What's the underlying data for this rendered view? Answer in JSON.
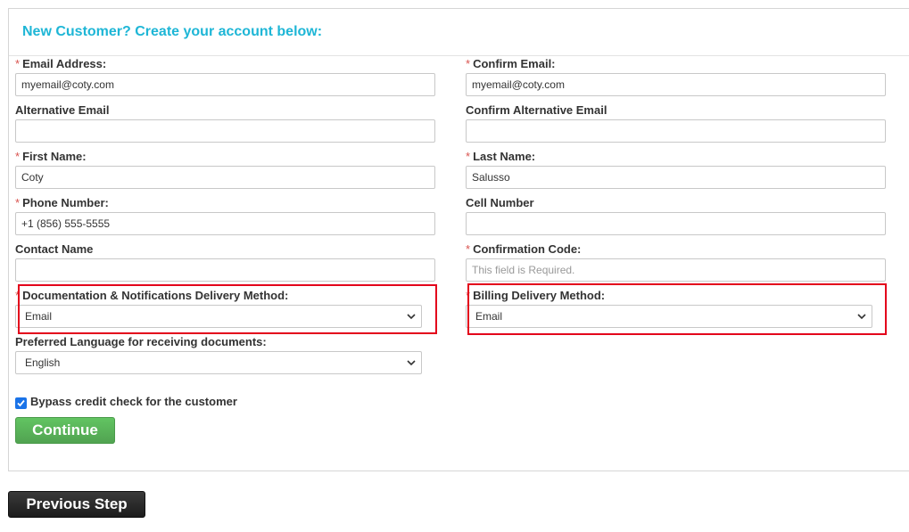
{
  "form": {
    "title": "New Customer? Create your account below:",
    "required_marker": "*",
    "left": {
      "email": {
        "label": "Email Address:",
        "value": "myemail@coty.com"
      },
      "alt_email": {
        "label": "Alternative Email",
        "value": ""
      },
      "first_name": {
        "label": "First Name:",
        "value": "Coty"
      },
      "phone": {
        "label": "Phone Number:",
        "value": "+1 (856) 555-5555"
      },
      "contact_name": {
        "label": "Contact Name",
        "value": ""
      },
      "doc_delivery": {
        "label": "Documentation & Notifications Delivery Method:",
        "value": "Email"
      },
      "language": {
        "label": "Preferred Language for receiving documents:",
        "value": "English"
      }
    },
    "right": {
      "confirm_email": {
        "label": "Confirm Email:",
        "value": "myemail@coty.com"
      },
      "confirm_alt_email": {
        "label": "Confirm Alternative Email",
        "value": ""
      },
      "last_name": {
        "label": "Last Name:",
        "value": "Salusso"
      },
      "cell": {
        "label": "Cell Number",
        "value": ""
      },
      "confirmation_code": {
        "label": "Confirmation Code:",
        "placeholder": "This field is Required."
      },
      "billing_delivery": {
        "label": "Billing Delivery Method:",
        "value": "Email"
      }
    },
    "bypass_credit_check": {
      "label": "Bypass credit check for the customer",
      "checked": true
    },
    "continue_label": "Continue"
  },
  "footer": {
    "previous_label": "Previous Step"
  },
  "colors": {
    "title": "#1eb6d6",
    "required": "#d9534f",
    "highlight": "#e3001b",
    "continue": "#5cb85c",
    "previous": "#222222"
  }
}
